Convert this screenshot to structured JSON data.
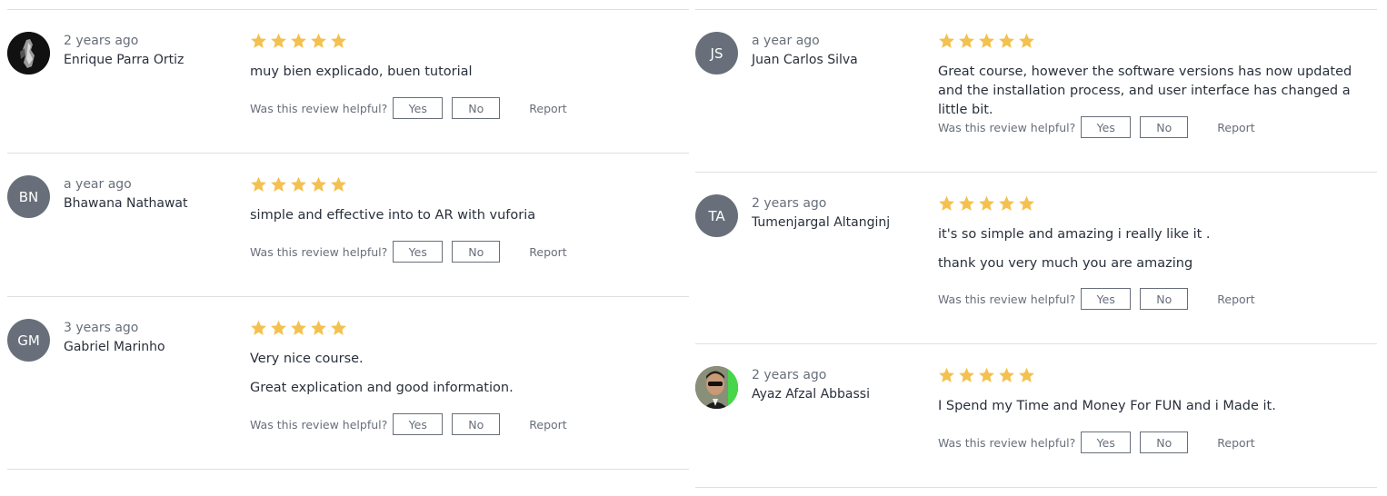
{
  "ui": {
    "helpful_question": "Was this review helpful?",
    "yes_label": "Yes",
    "no_label": "No",
    "report_label": "Report",
    "star_color": "#f4c150",
    "avatar_color": "#686f7a"
  },
  "reviews_left": [
    {
      "time": "2 years ago",
      "name": "Enrique Parra Ortiz",
      "rating": 5,
      "avatar": "photo",
      "lines": [
        "muy bien explicado, buen tutorial"
      ]
    },
    {
      "time": "a year ago",
      "name": "Bhawana Nathawat",
      "rating": 5,
      "initials": "BN",
      "lines": [
        "simple and effective into to AR with vuforia"
      ]
    },
    {
      "time": "3 years ago",
      "name": "Gabriel Marinho",
      "rating": 5,
      "initials": "GM",
      "lines": [
        "Very nice course.",
        "Great explication and good information."
      ]
    }
  ],
  "reviews_right": [
    {
      "time": "a year ago",
      "name": "Juan Carlos Silva",
      "rating": 5,
      "initials": "JS",
      "lines": [
        "Great course, however the software versions has now updated and the installation process, and user interface has changed a little bit."
      ]
    },
    {
      "time": "2 years ago",
      "name": "Tumenjargal Altanginj",
      "rating": 5,
      "initials": "TA",
      "lines": [
        "it's so simple and amazing i really like it .",
        "thank you very much you are amazing"
      ]
    },
    {
      "time": "2 years ago",
      "name": "Ayaz Afzal Abbassi",
      "rating": 5,
      "avatar": "photo",
      "lines": [
        "I Spend my Time and Money For FUN and i Made it."
      ]
    }
  ]
}
